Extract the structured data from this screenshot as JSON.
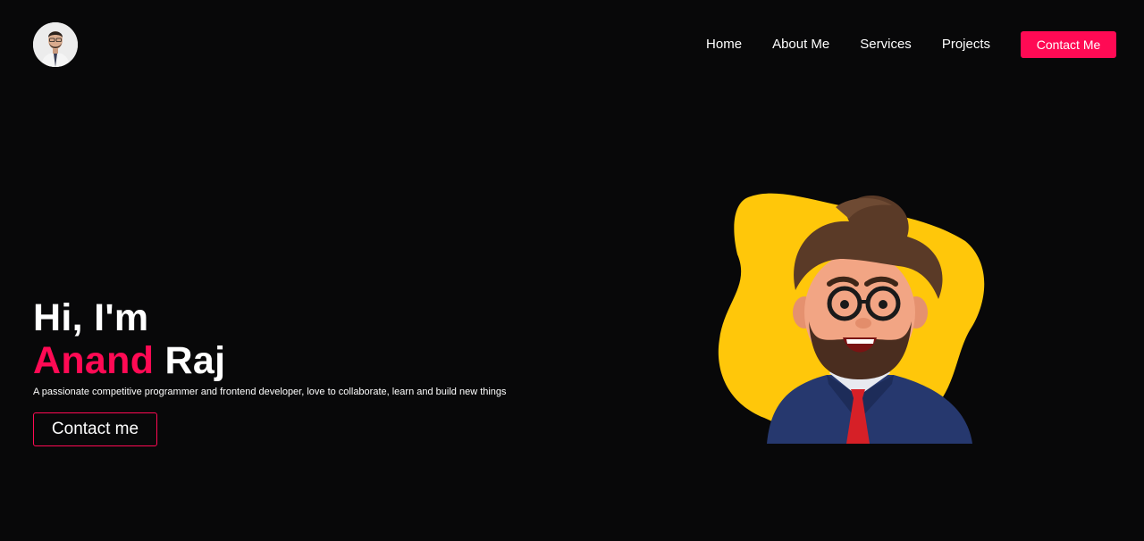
{
  "header": {
    "avatar_icon": "profile-photo",
    "nav": [
      {
        "label": "Home"
      },
      {
        "label": "About Me"
      },
      {
        "label": "Services"
      },
      {
        "label": "Projects"
      }
    ],
    "cta_label": "Contact Me"
  },
  "hero": {
    "greeting": "Hi, I'm",
    "first_name": "Anand",
    "last_name": "Raj",
    "tagline": "A passionate competitive programmer and frontend developer, love to collaborate, learn and build new things",
    "cta_label": "Contact me"
  },
  "illustration": {
    "icon": "cartoon-developer-avatar"
  },
  "colors": {
    "background": "#080809",
    "accent": "#ff0a54",
    "blob": "#ffc70a",
    "text": "#ffffff"
  }
}
